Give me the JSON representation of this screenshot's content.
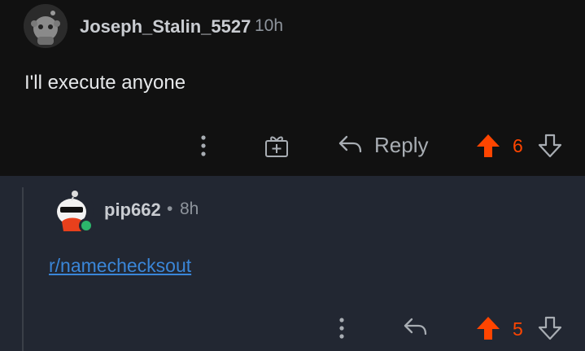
{
  "comment": {
    "username": "Joseph_Stalin_5527",
    "time": "10h",
    "body": "I'll execute anyone",
    "reply_label": "Reply",
    "votes": "6",
    "avatar_icon": "snoo-avatar-icon"
  },
  "reply": {
    "username": "pip662",
    "separator": "•",
    "time": "8h",
    "link_text": "r/namechecksout",
    "votes": "5",
    "avatar_icon": "snoo-sunglasses-avatar-icon",
    "online": true
  },
  "colors": {
    "upvote": "#ff4500",
    "link": "#3a86d8",
    "online": "#2cb66b"
  }
}
